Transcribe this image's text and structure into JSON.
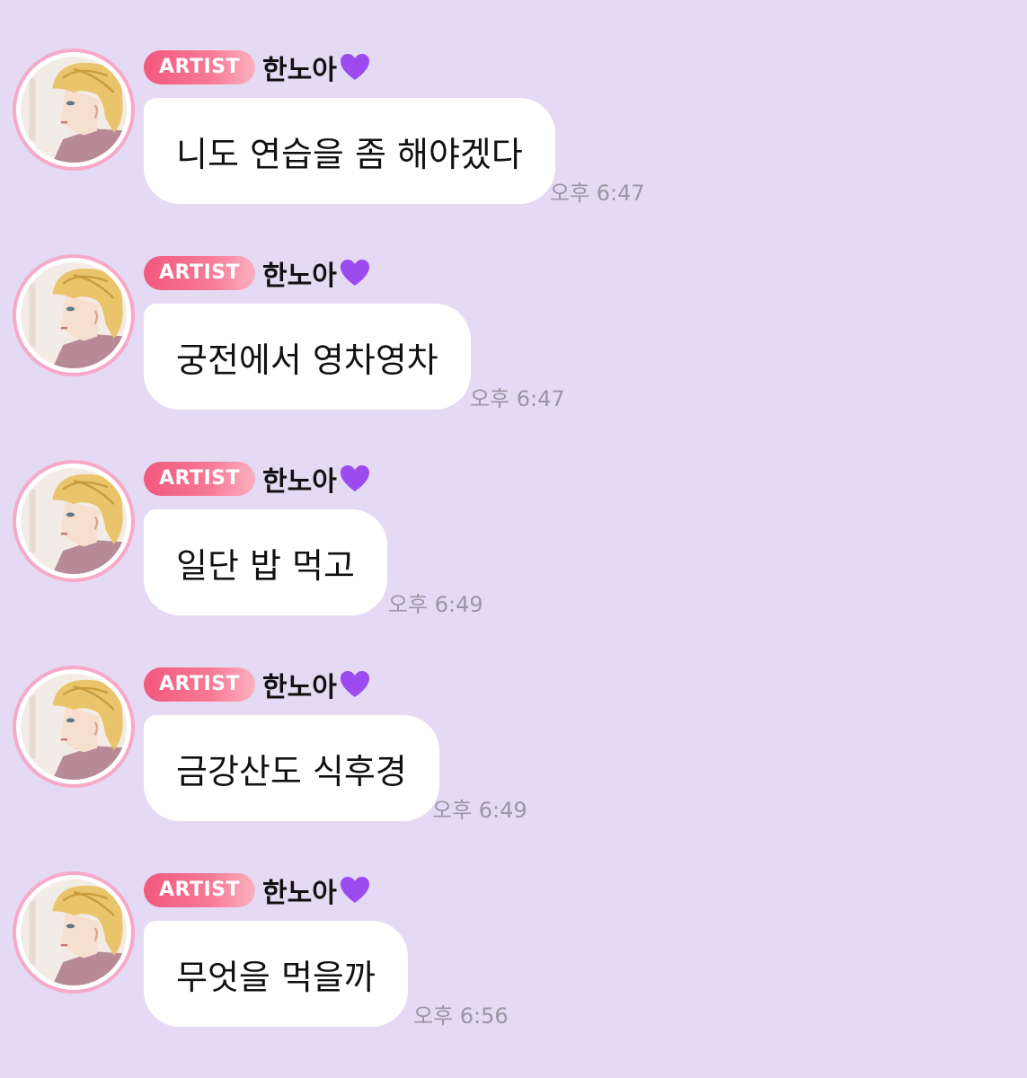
{
  "colors": {
    "background": "#e5daf3",
    "badge": "#f2587d",
    "avatar_ring": "#f7a9c8",
    "bubble": "#ffffff",
    "time": "#9a96a4",
    "heart": "#9b4bf0"
  },
  "sender": {
    "badge": "ARTIST",
    "name": "한노아",
    "heart_icon": "purple-heart-icon"
  },
  "messages": [
    {
      "text": "니도 연습을 좀 해야겠다",
      "time": "오후 6:47"
    },
    {
      "text": "궁전에서 영차영차",
      "time": "오후 6:47"
    },
    {
      "text": "일단 밥 먹고",
      "time": "오후 6:49"
    },
    {
      "text": "금강산도 식후경",
      "time": "오후 6:49"
    },
    {
      "text": "무엇을 먹을까",
      "time": "오후 6:56"
    }
  ]
}
